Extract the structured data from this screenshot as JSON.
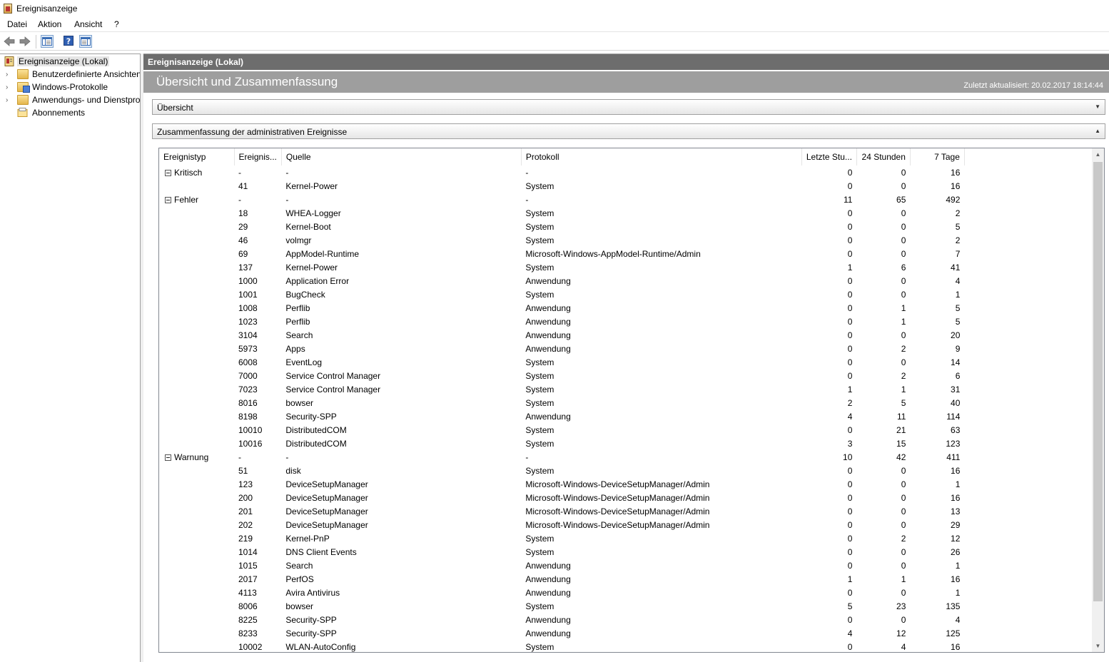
{
  "window": {
    "title": "Ereignisanzeige"
  },
  "menu": [
    "Datei",
    "Aktion",
    "Ansicht",
    "?"
  ],
  "tree": {
    "root": "Ereignisanzeige (Lokal)",
    "items": [
      "Benutzerdefinierte Ansichten",
      "Windows-Protokolle",
      "Anwendungs- und Dienstprotokolle",
      "Abonnements"
    ]
  },
  "right": {
    "header": "Ereignisanzeige (Lokal)",
    "banner_title": "Übersicht und Zusammenfassung",
    "updated": "Zuletzt aktualisiert: 20.02.2017 18:14:44",
    "section_overview": "Übersicht",
    "section_summary": "Zusammenfassung der administrativen Ereignisse"
  },
  "table": {
    "columns": [
      "Ereignistyp",
      "Ereignis...",
      "Quelle",
      "Protokoll",
      "Letzte Stu...",
      "24 Stunden",
      "7 Tage"
    ],
    "rows": [
      [
        "Kritisch",
        "-",
        "-",
        "-",
        "0",
        "0",
        "16"
      ],
      [
        "",
        "41",
        "Kernel-Power",
        "System",
        "0",
        "0",
        "16"
      ],
      [
        "Fehler",
        "-",
        "-",
        "-",
        "11",
        "65",
        "492"
      ],
      [
        "",
        "18",
        "WHEA-Logger",
        "System",
        "0",
        "0",
        "2"
      ],
      [
        "",
        "29",
        "Kernel-Boot",
        "System",
        "0",
        "0",
        "5"
      ],
      [
        "",
        "46",
        "volmgr",
        "System",
        "0",
        "0",
        "2"
      ],
      [
        "",
        "69",
        "AppModel-Runtime",
        "Microsoft-Windows-AppModel-Runtime/Admin",
        "0",
        "0",
        "7"
      ],
      [
        "",
        "137",
        "Kernel-Power",
        "System",
        "1",
        "6",
        "41"
      ],
      [
        "",
        "1000",
        "Application Error",
        "Anwendung",
        "0",
        "0",
        "4"
      ],
      [
        "",
        "1001",
        "BugCheck",
        "System",
        "0",
        "0",
        "1"
      ],
      [
        "",
        "1008",
        "Perflib",
        "Anwendung",
        "0",
        "1",
        "5"
      ],
      [
        "",
        "1023",
        "Perflib",
        "Anwendung",
        "0",
        "1",
        "5"
      ],
      [
        "",
        "3104",
        "Search",
        "Anwendung",
        "0",
        "0",
        "20"
      ],
      [
        "",
        "5973",
        "Apps",
        "Anwendung",
        "0",
        "2",
        "9"
      ],
      [
        "",
        "6008",
        "EventLog",
        "System",
        "0",
        "0",
        "14"
      ],
      [
        "",
        "7000",
        "Service Control Manager",
        "System",
        "0",
        "2",
        "6"
      ],
      [
        "",
        "7023",
        "Service Control Manager",
        "System",
        "1",
        "1",
        "31"
      ],
      [
        "",
        "8016",
        "bowser",
        "System",
        "2",
        "5",
        "40"
      ],
      [
        "",
        "8198",
        "Security-SPP",
        "Anwendung",
        "4",
        "11",
        "114"
      ],
      [
        "",
        "10010",
        "DistributedCOM",
        "System",
        "0",
        "21",
        "63"
      ],
      [
        "",
        "10016",
        "DistributedCOM",
        "System",
        "3",
        "15",
        "123"
      ],
      [
        "Warnung",
        "-",
        "-",
        "-",
        "10",
        "42",
        "411"
      ],
      [
        "",
        "51",
        "disk",
        "System",
        "0",
        "0",
        "16"
      ],
      [
        "",
        "123",
        "DeviceSetupManager",
        "Microsoft-Windows-DeviceSetupManager/Admin",
        "0",
        "0",
        "1"
      ],
      [
        "",
        "200",
        "DeviceSetupManager",
        "Microsoft-Windows-DeviceSetupManager/Admin",
        "0",
        "0",
        "16"
      ],
      [
        "",
        "201",
        "DeviceSetupManager",
        "Microsoft-Windows-DeviceSetupManager/Admin",
        "0",
        "0",
        "13"
      ],
      [
        "",
        "202",
        "DeviceSetupManager",
        "Microsoft-Windows-DeviceSetupManager/Admin",
        "0",
        "0",
        "29"
      ],
      [
        "",
        "219",
        "Kernel-PnP",
        "System",
        "0",
        "2",
        "12"
      ],
      [
        "",
        "1014",
        "DNS Client Events",
        "System",
        "0",
        "0",
        "26"
      ],
      [
        "",
        "1015",
        "Search",
        "Anwendung",
        "0",
        "0",
        "1"
      ],
      [
        "",
        "2017",
        "PerfOS",
        "Anwendung",
        "1",
        "1",
        "16"
      ],
      [
        "",
        "4113",
        "Avira Antivirus",
        "Anwendung",
        "0",
        "0",
        "1"
      ],
      [
        "",
        "8006",
        "bowser",
        "System",
        "5",
        "23",
        "135"
      ],
      [
        "",
        "8225",
        "Security-SPP",
        "Anwendung",
        "0",
        "0",
        "4"
      ],
      [
        "",
        "8233",
        "Security-SPP",
        "Anwendung",
        "4",
        "12",
        "125"
      ],
      [
        "",
        "10002",
        "WLAN-AutoConfig",
        "System",
        "0",
        "4",
        "16"
      ]
    ]
  }
}
